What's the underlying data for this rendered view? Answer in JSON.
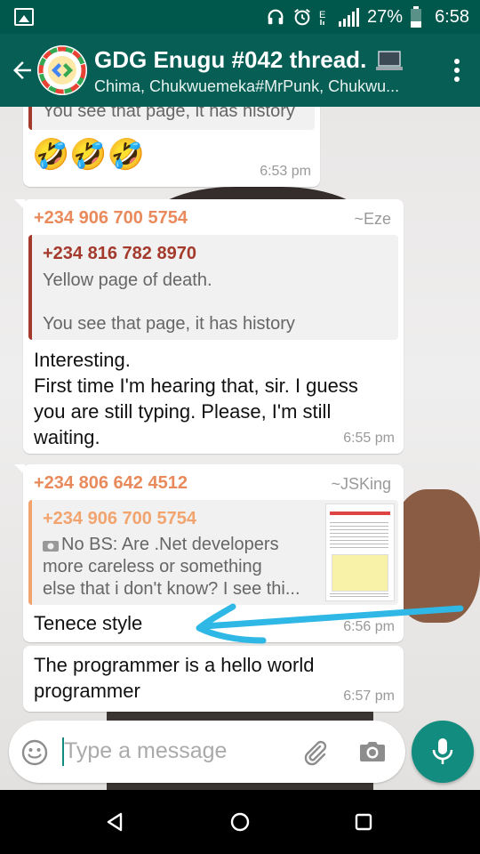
{
  "status_bar": {
    "battery": "27%",
    "time": "6:58"
  },
  "header": {
    "title": "GDG Enugu #042 thread.",
    "subtitle": "Chima, Chukwuemeka#MrPunk, Chukwu..."
  },
  "messages": [
    {
      "quote_line": "You see that page, it has history",
      "emoji": "🤣🤣🤣",
      "time": "6:53 pm"
    },
    {
      "sender": "+234 906 700 5754",
      "alias": "~Eze",
      "quote": {
        "sender": "+234 816 782 8970",
        "line1": "Yellow page of death.",
        "line2": "You see that page, it has history"
      },
      "lines": [
        "Interesting.",
        "First time I'm hearing that, sir. I guess",
        "you are still typing. Please, I'm still",
        "waiting."
      ],
      "time": "6:55 pm"
    },
    {
      "sender": "+234 806 642 4512",
      "alias": "~JSKing",
      "quote": {
        "sender": "+234 906 700 5754",
        "line1": "No BS: Are .Net developers",
        "line2": "more careless or something",
        "line3": "else that i don't know?  I see thi..."
      },
      "text": "Tenece style",
      "time": "6:56 pm"
    },
    {
      "lines": [
        "The programmer is a hello world",
        "programmer"
      ],
      "time": "6:57 pm"
    }
  ],
  "composer": {
    "placeholder": "Type a message"
  },
  "colors": {
    "header": "#075e54",
    "status_bar": "#00574b",
    "accent": "#128c7e",
    "annotation": "#2fb8e6",
    "sender_orange": "#e88a5b",
    "quote_bar_red": "#a33a2b"
  },
  "icons": [
    "gallery-icon",
    "headphones-icon",
    "alarm-icon",
    "signal-icon",
    "battery-icon",
    "back-arrow-icon",
    "laptop-icon",
    "more-vert-icon",
    "emoji-icon",
    "attach-icon",
    "camera-icon",
    "mic-icon",
    "nav-back-icon",
    "nav-home-icon",
    "nav-recents-icon"
  ]
}
